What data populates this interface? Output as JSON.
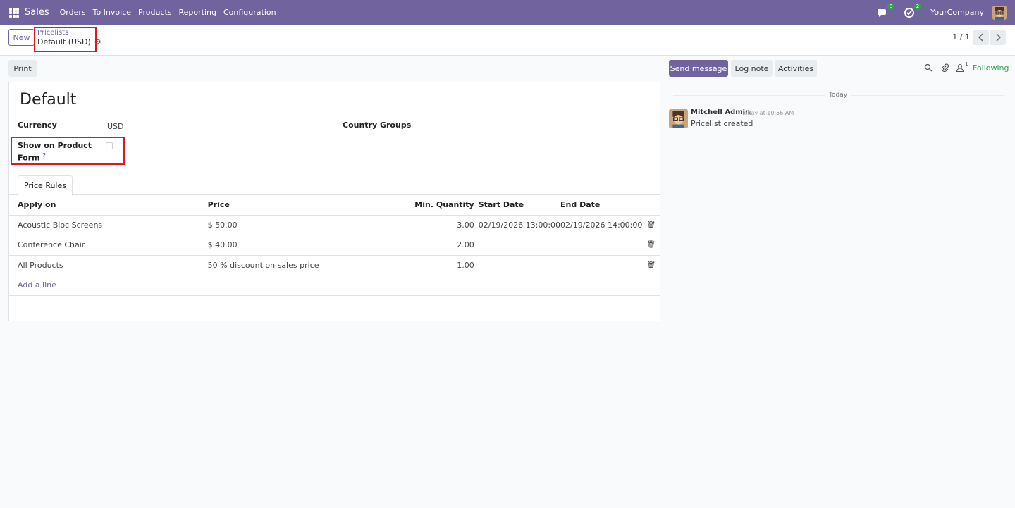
{
  "topbar": {
    "app_name": "Sales",
    "menu": [
      "Orders",
      "To Invoice",
      "Products",
      "Reporting",
      "Configuration"
    ],
    "messages_badge": "8",
    "activities_badge": "2",
    "company": "YourCompany"
  },
  "control": {
    "new_label": "New",
    "breadcrumb_parent": "Pricelists",
    "breadcrumb_current": "Default (USD)",
    "pager": "1 / 1"
  },
  "toolbar": {
    "print_label": "Print"
  },
  "form": {
    "title": "Default",
    "currency_label": "Currency",
    "currency_value": "USD",
    "country_groups_label": "Country Groups",
    "show_on_product_label_1": "Show on Product",
    "show_on_product_label_2": "Form",
    "help_mark": "?",
    "show_on_product_checked": false,
    "tab": "Price Rules",
    "columns": [
      "Apply on",
      "Price",
      "Min. Quantity",
      "Start Date",
      "End Date"
    ],
    "rows": [
      {
        "apply_on": "Acoustic Bloc Screens",
        "price": "$ 50.00",
        "min_qty": "3.00",
        "start": "02/19/2026 13:00:00",
        "end": "02/19/2026 14:00:00"
      },
      {
        "apply_on": "Conference Chair",
        "price": "$ 40.00",
        "min_qty": "2.00",
        "start": "",
        "end": ""
      },
      {
        "apply_on": "All Products",
        "price": "50 % discount on sales price",
        "min_qty": "1.00",
        "start": "",
        "end": ""
      }
    ],
    "add_line": "Add a line"
  },
  "chatter": {
    "send_message": "Send message",
    "log_note": "Log note",
    "activities": "Activities",
    "follower_count": "1",
    "following": "Following",
    "date_separator": "Today",
    "author": "Mitchell Admin",
    "timestamp": "Today at 10:56 AM",
    "body": "Pricelist created"
  },
  "colors": {
    "brand": "#71639e",
    "highlight": "#e0181d",
    "following": "#28a745"
  }
}
